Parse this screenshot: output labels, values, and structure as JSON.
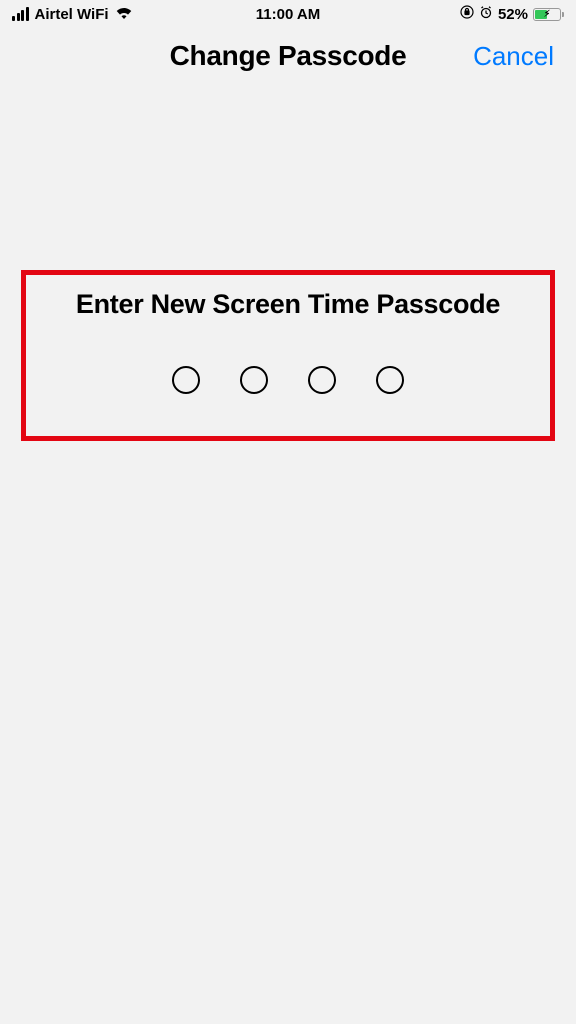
{
  "status_bar": {
    "carrier": "Airtel WiFi",
    "time": "11:00 AM",
    "battery_percent": "52%"
  },
  "nav": {
    "title": "Change Passcode",
    "cancel": "Cancel"
  },
  "main": {
    "prompt": "Enter New Screen Time Passcode",
    "digits": 4,
    "filled": 0
  }
}
